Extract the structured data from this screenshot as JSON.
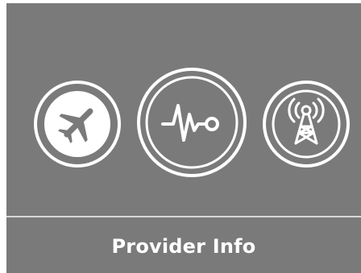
{
  "menu": {
    "items": [
      {
        "icon": "airplane-icon"
      },
      {
        "icon": "pulse-signal-icon",
        "selected": true
      },
      {
        "icon": "radio-tower-icon"
      }
    ],
    "selected_label": "Provider Info"
  },
  "colors": {
    "background": "#7a7a7a",
    "foreground": "#ffffff",
    "divider": "#d8d8d8"
  }
}
